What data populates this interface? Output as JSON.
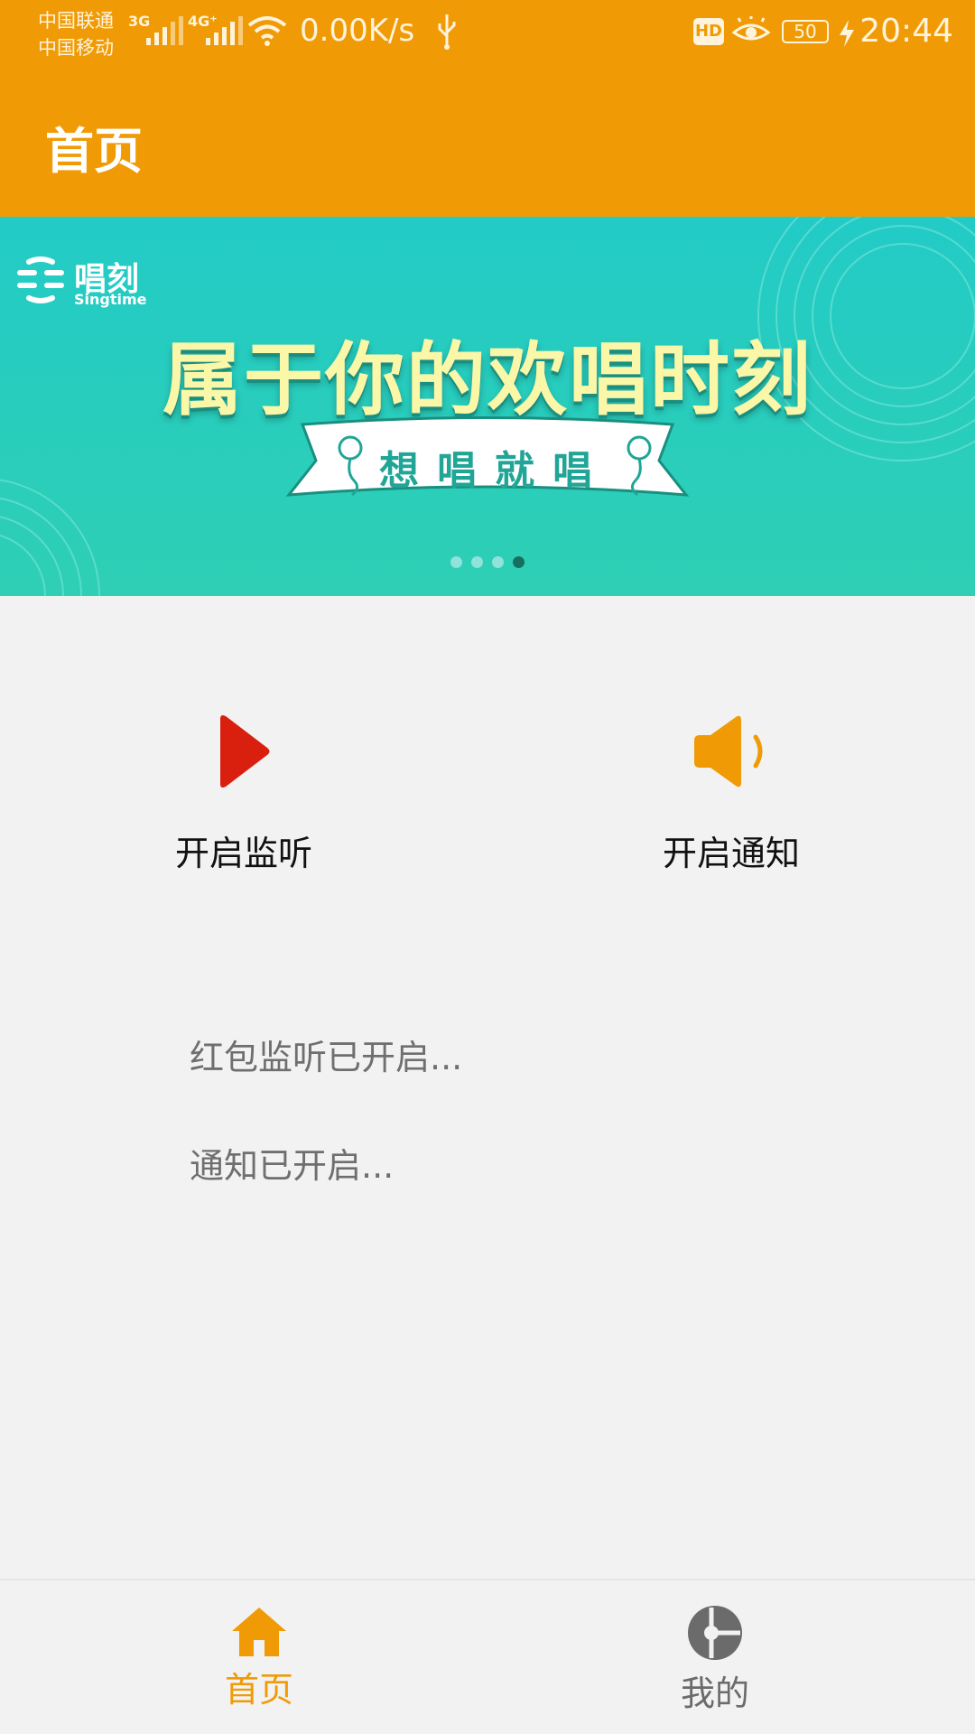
{
  "status_bar": {
    "carrier1": "中国联通",
    "carrier2": "中国移动",
    "net1": "3G",
    "net2": "4G⁺",
    "speed": "0.00K/s",
    "hd": "HD",
    "battery": "50",
    "time": "20:44"
  },
  "app_bar": {
    "title": "首页"
  },
  "banner": {
    "logo_text": "唱刻",
    "logo_sub": "Singtime",
    "headline": "属于你的欢唱时刻",
    "ribbon": "想唱就唱",
    "dots_count": 4,
    "active_dot": 4
  },
  "actions": {
    "monitor_label": "开启监听",
    "notify_label": "开启通知"
  },
  "status_lines": {
    "monitor": "红包监听已开启...",
    "notify": "通知已开启..."
  },
  "bottom_nav": {
    "home_label": "首页",
    "mine_label": "我的"
  },
  "colors": {
    "accent": "#f09b05",
    "banner": "#22cbc6",
    "play_red": "#d9200e",
    "inactive_gray": "#6b6b6b"
  }
}
